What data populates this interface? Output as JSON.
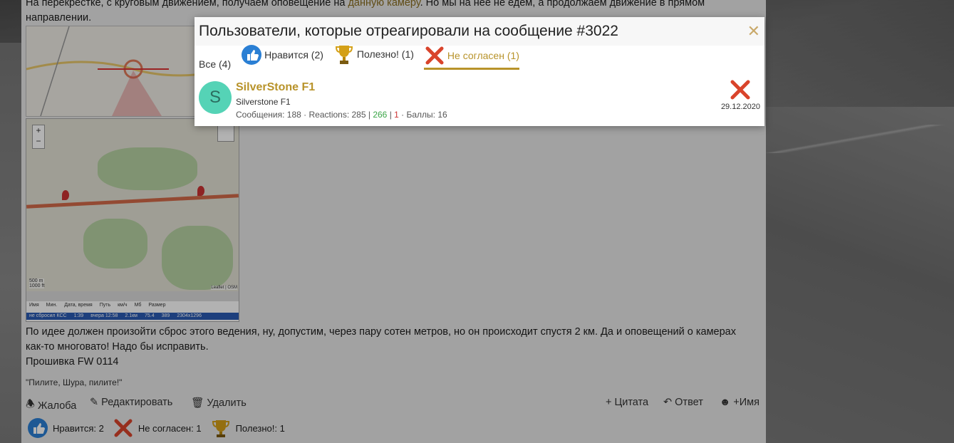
{
  "post": {
    "line1_pre": "На перекрестке, с круговым движением, получаем оповещение на ",
    "line1_link": "данную камеру",
    "line1_post": ". Но мы на нее не едем, а продолжаем движение в прямом",
    "line2": "направлении.",
    "para2_line1": "По идее должен произойти сброс этого ведения, ну, допустим, через пару сотен метров, но он происходит спустя 2 км. Да и оповещений о камерах",
    "para2_line2": "как-то многовато! Надо бы исправить.",
    "firmware": "Прошивка FW 0114",
    "signature": "\"Пилите, Шура, пилите!\""
  },
  "map": {
    "zoom_in": "+",
    "zoom_out": "−",
    "scale_top": "500 m",
    "scale_bottom": "1000 ft",
    "attribution": "Leaflet | OSM",
    "table_cols": [
      "Имя",
      "Мин.",
      "Дата, время",
      "Путь",
      "км/ч",
      "Мб",
      "Размер"
    ],
    "table_row": [
      "не сбросил КСС",
      "1:39",
      "вчера 12:58",
      "2.1км",
      "75.4",
      "389",
      "2304x1296"
    ]
  },
  "actions": {
    "report": "Жалоба",
    "edit": "Редактировать",
    "delete": "Удалить",
    "quote": "+ Цитата",
    "reply": "Ответ",
    "name": "+Имя"
  },
  "reactions_summary": [
    {
      "icon": "like-icon",
      "label": "Нравится: 2"
    },
    {
      "icon": "disagree-icon",
      "label": "Не согласен: 1"
    },
    {
      "icon": "trophy-icon",
      "label": "Полезно!: 1"
    }
  ],
  "modal": {
    "title": "Пользователи, которые отреагировали на сообщение #3022",
    "close": "✕",
    "tabs": [
      {
        "label": "Все (4)",
        "icon": ""
      },
      {
        "label": "Нравится (2)",
        "icon": "like-icon"
      },
      {
        "label": "Полезно! (1)",
        "icon": "trophy-icon"
      },
      {
        "label": "Не согласен (1)",
        "icon": "disagree-icon",
        "active": true
      }
    ],
    "user": {
      "avatar_letter": "S",
      "name": "SilverStone F1",
      "title": "Silverstone F1",
      "stats_pre": "Сообщения: 188 · Reactions: 285 | ",
      "stats_green": "266",
      "stats_sep": " | ",
      "stats_red": "1",
      "stats_post": " · Баллы: 16",
      "reaction_date": "29.12.2020"
    }
  },
  "colors": {
    "accent": "#b8932a",
    "avatar": "#55d3b6",
    "like": "#2a7fd4",
    "disagree": "#d9442b"
  }
}
